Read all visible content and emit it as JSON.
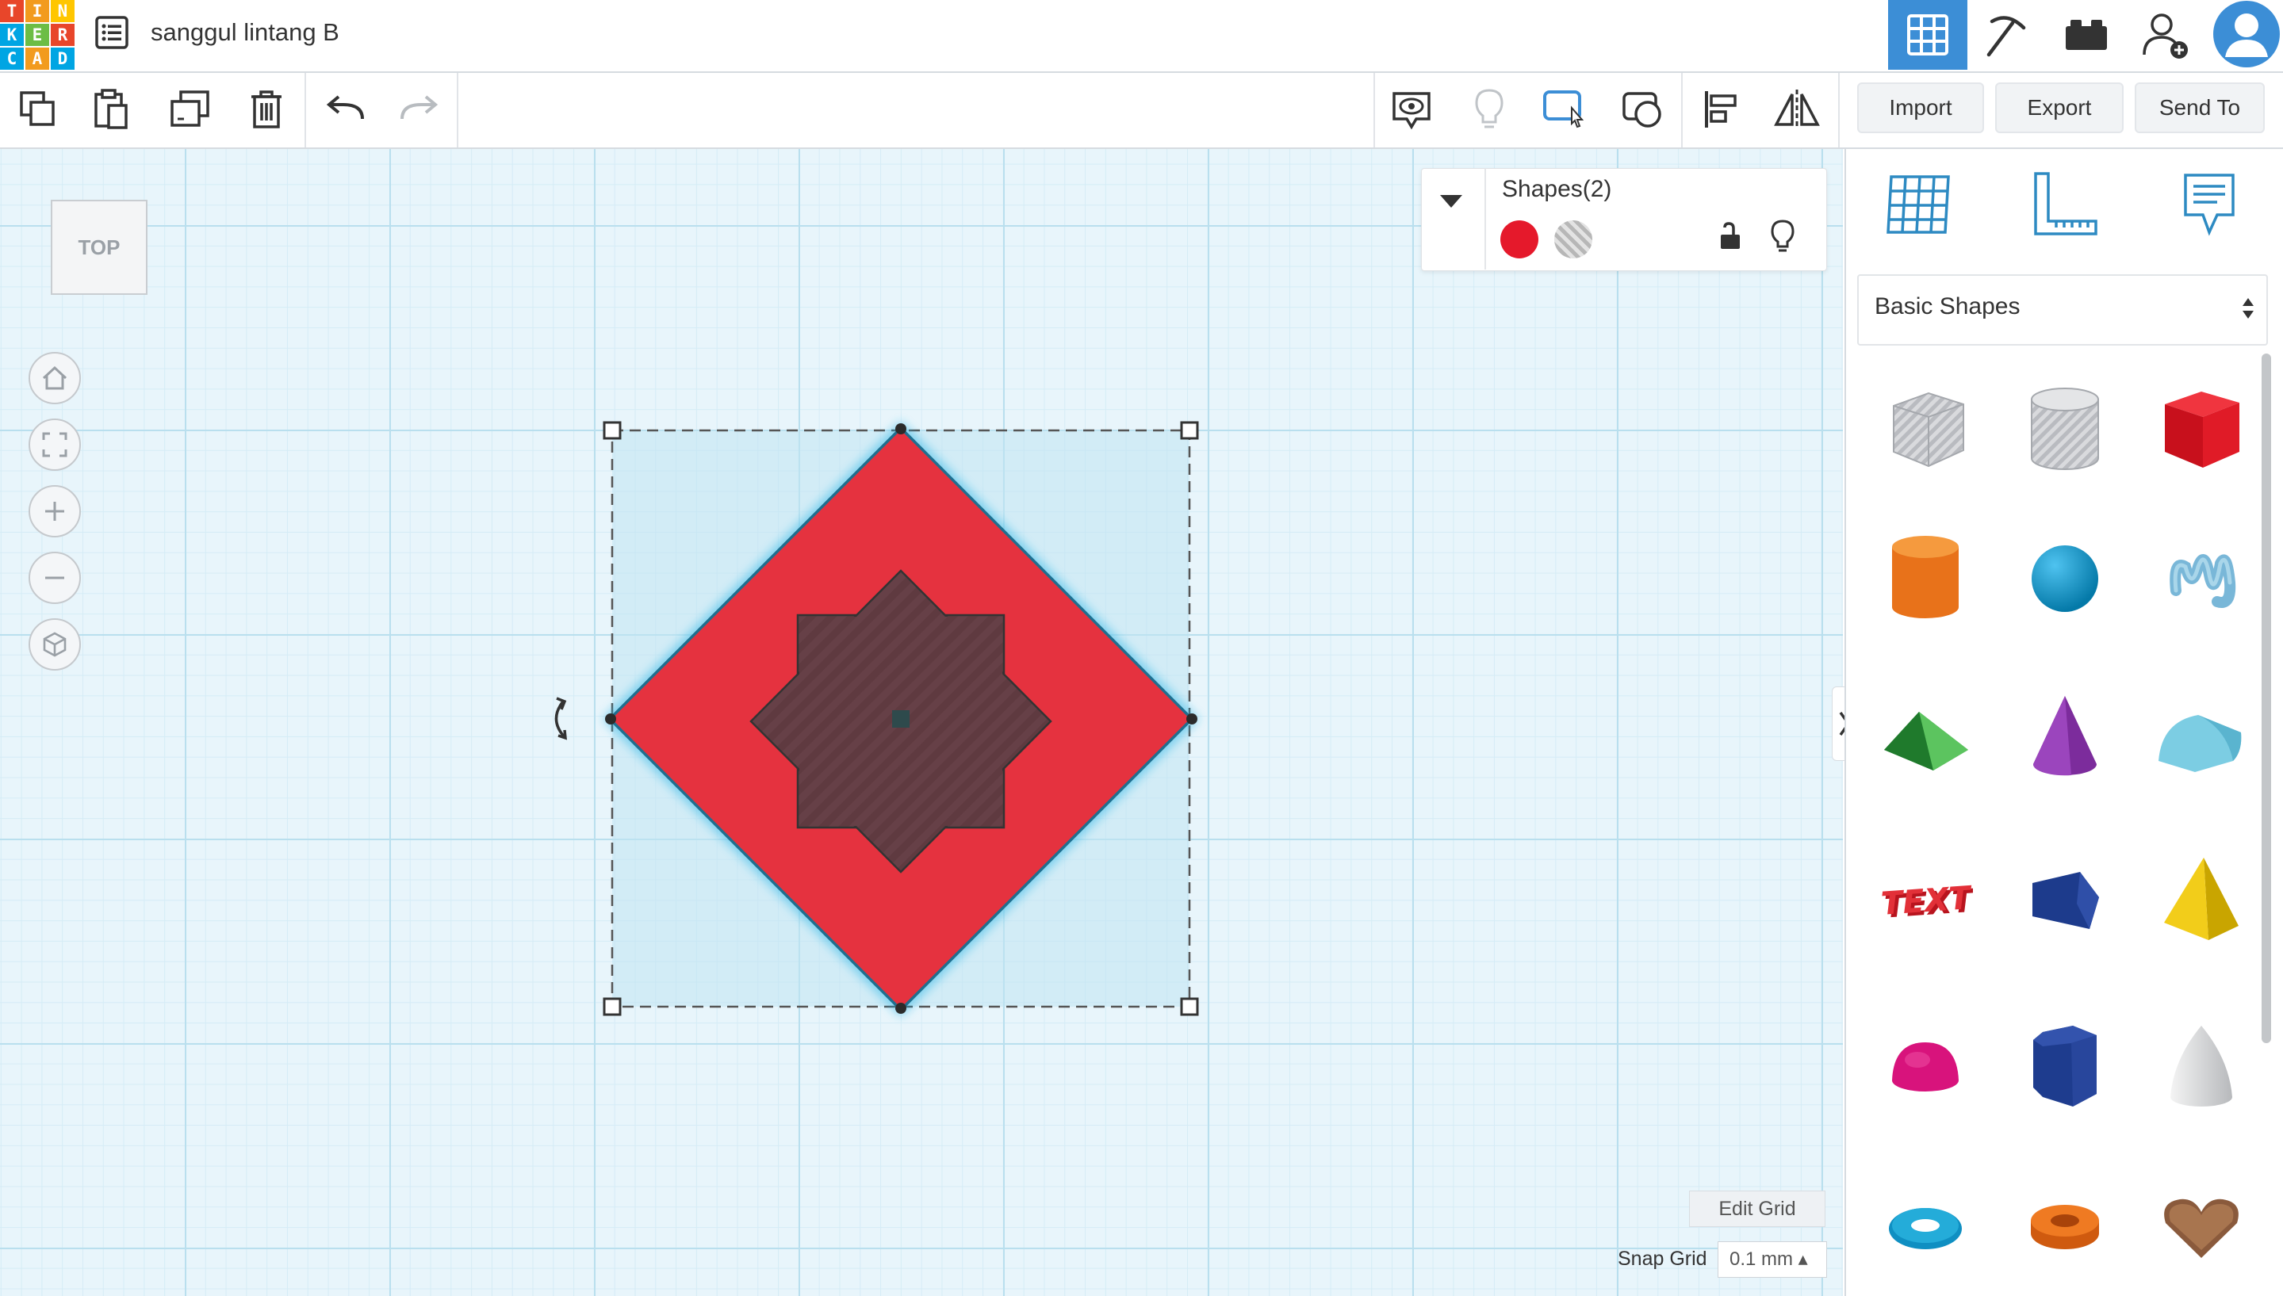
{
  "app": {
    "logo_letters": [
      "T",
      "I",
      "N",
      "K",
      "E",
      "R",
      "C",
      "A",
      "D"
    ],
    "logo_colors": [
      "#e8462a",
      "#f29b1e",
      "#ffc600",
      "#00a5e3",
      "#6cbd45",
      "#e8462a",
      "#00a5e3",
      "#f29b1e",
      "#00a5e3"
    ],
    "project_title": "sanggul lintang B"
  },
  "toolbar": {
    "import_label": "Import",
    "export_label": "Export",
    "send_to_label": "Send To"
  },
  "workplane": {
    "view_label": "TOP",
    "edit_grid_label": "Edit Grid",
    "snap_grid_label": "Snap Grid",
    "snap_grid_value": "0.1 mm ▴"
  },
  "shapes_panel": {
    "title": "Shapes(2)",
    "solid_color": "#e5192b"
  },
  "sidebar": {
    "category": "Basic Shapes",
    "category_arrow": "▴▾"
  },
  "colors": {
    "accent": "#3c8ed6",
    "shape_red": "#e5323f",
    "hole_dark": "#5e3a40",
    "selection": "#1f9fd0"
  }
}
